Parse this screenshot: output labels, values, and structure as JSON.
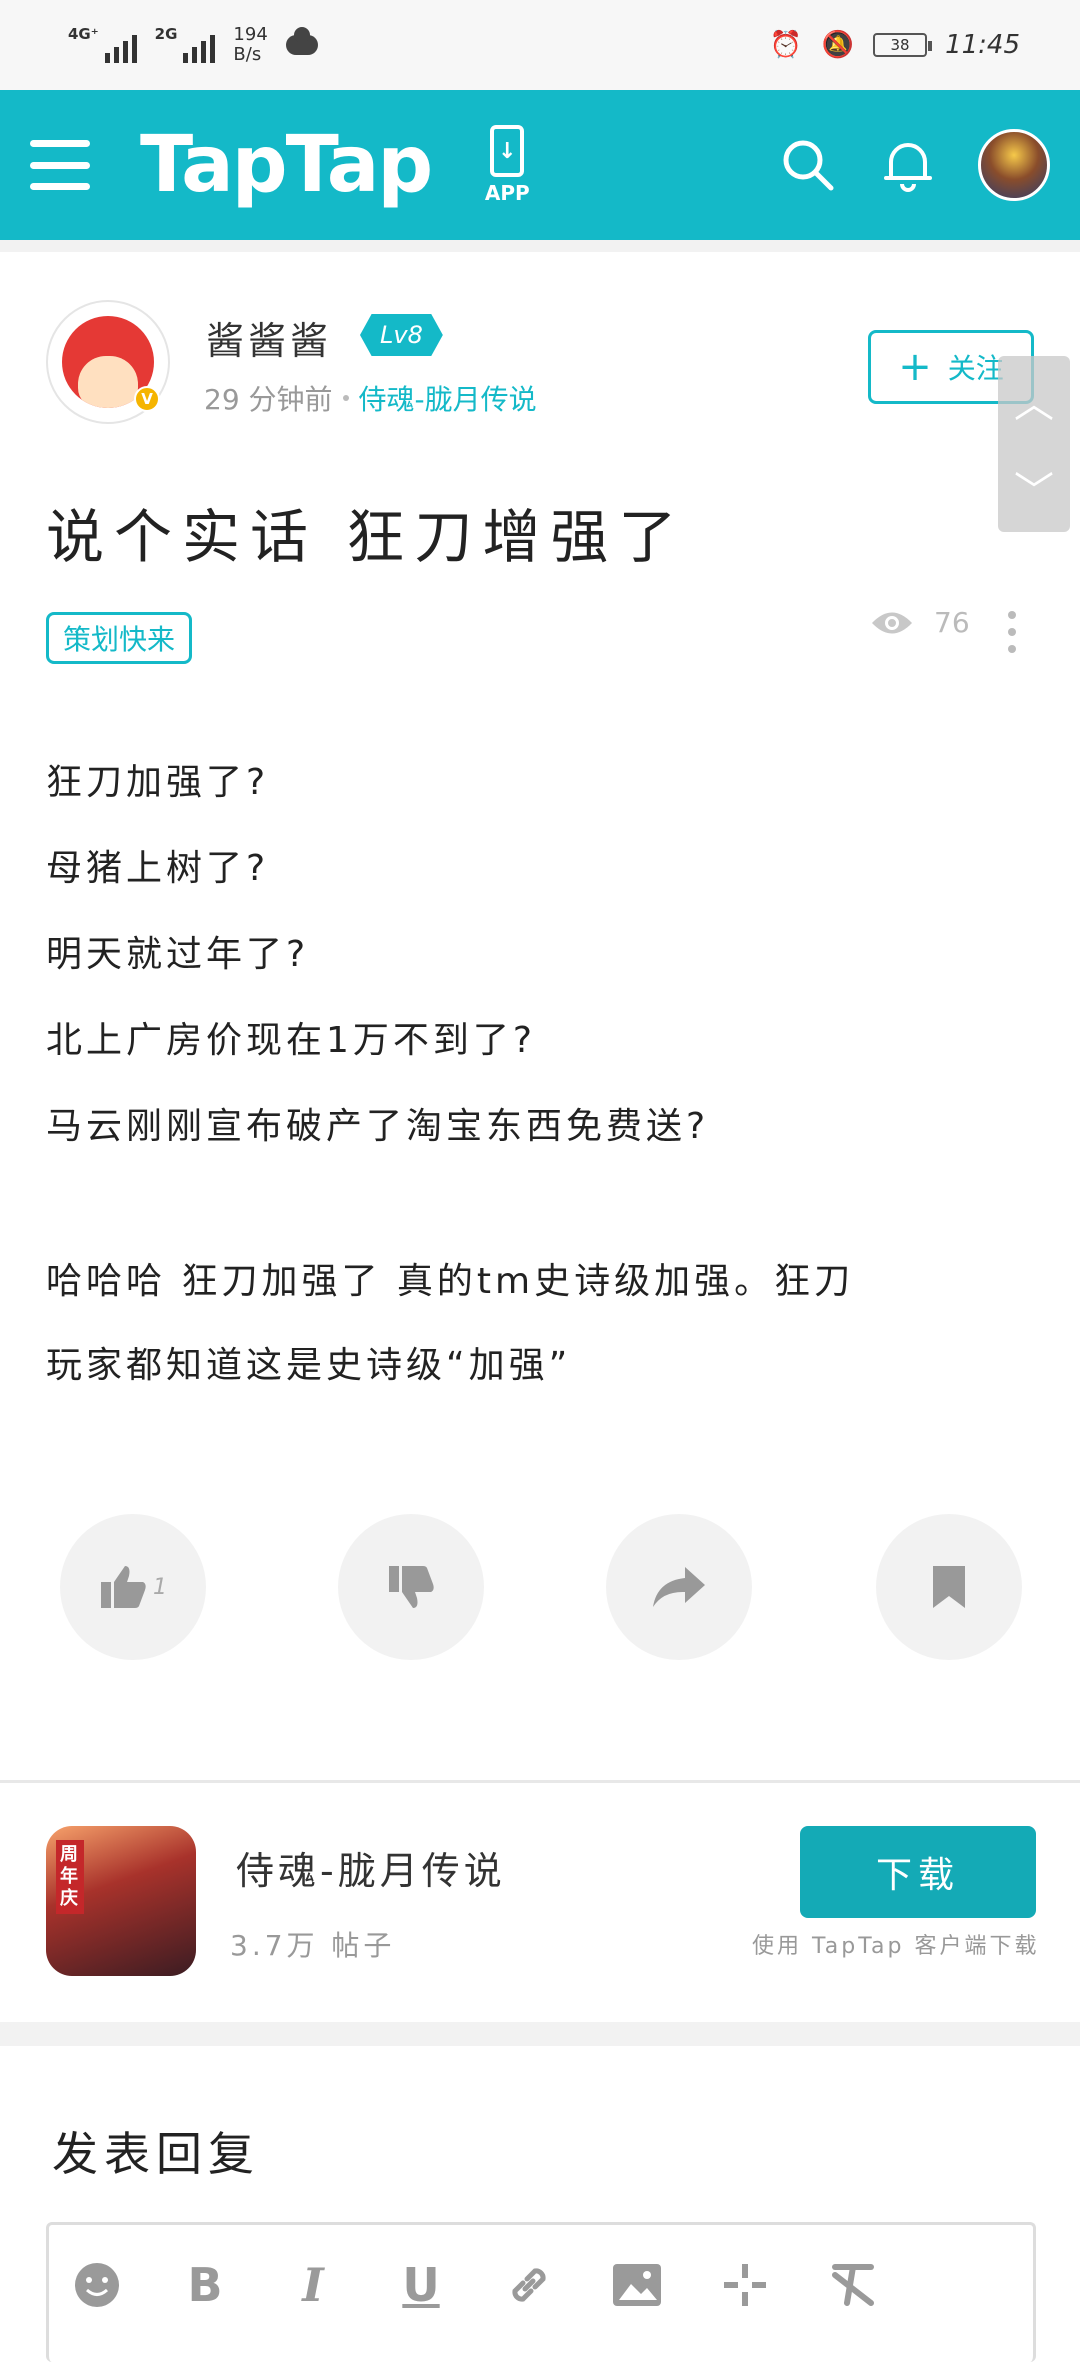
{
  "status_bar": {
    "network1": "4G⁺",
    "network2": "2G",
    "speed_value": "194",
    "speed_unit": "B/s",
    "battery": "38",
    "time": "11:45"
  },
  "header": {
    "logo": "TapTap",
    "app_label": "APP"
  },
  "post": {
    "author": "酱酱酱",
    "level": "Lv8",
    "time_ago": "29 分钟前",
    "game": "侍魂-胧月传说",
    "follow_label": "关注",
    "title": "说个实话 狂刀增强了",
    "tag": "策划快来",
    "views": "76",
    "body": [
      "狂刀加强了?",
      "母猪上树了?",
      "明天就过年了?",
      "北上广房价现在1万不到了?",
      "马云刚刚宣布破产了淘宝东西免费送?"
    ],
    "body2": [
      "哈哈哈 狂刀加强了 真的tm史诗级加强。狂刀",
      "玩家都知道这是史诗级“加强”"
    ],
    "like_count": "1"
  },
  "game_card": {
    "name": "侍魂-胧月传说",
    "posts": "3.7万 帖子",
    "download_label": "下载",
    "hint": "使用 TapTap 客户端下载",
    "icon_badge": "周年庆"
  },
  "reply": {
    "title": "发表回复"
  },
  "colors": {
    "accent": "#14b9c8",
    "download": "#14aab6"
  }
}
